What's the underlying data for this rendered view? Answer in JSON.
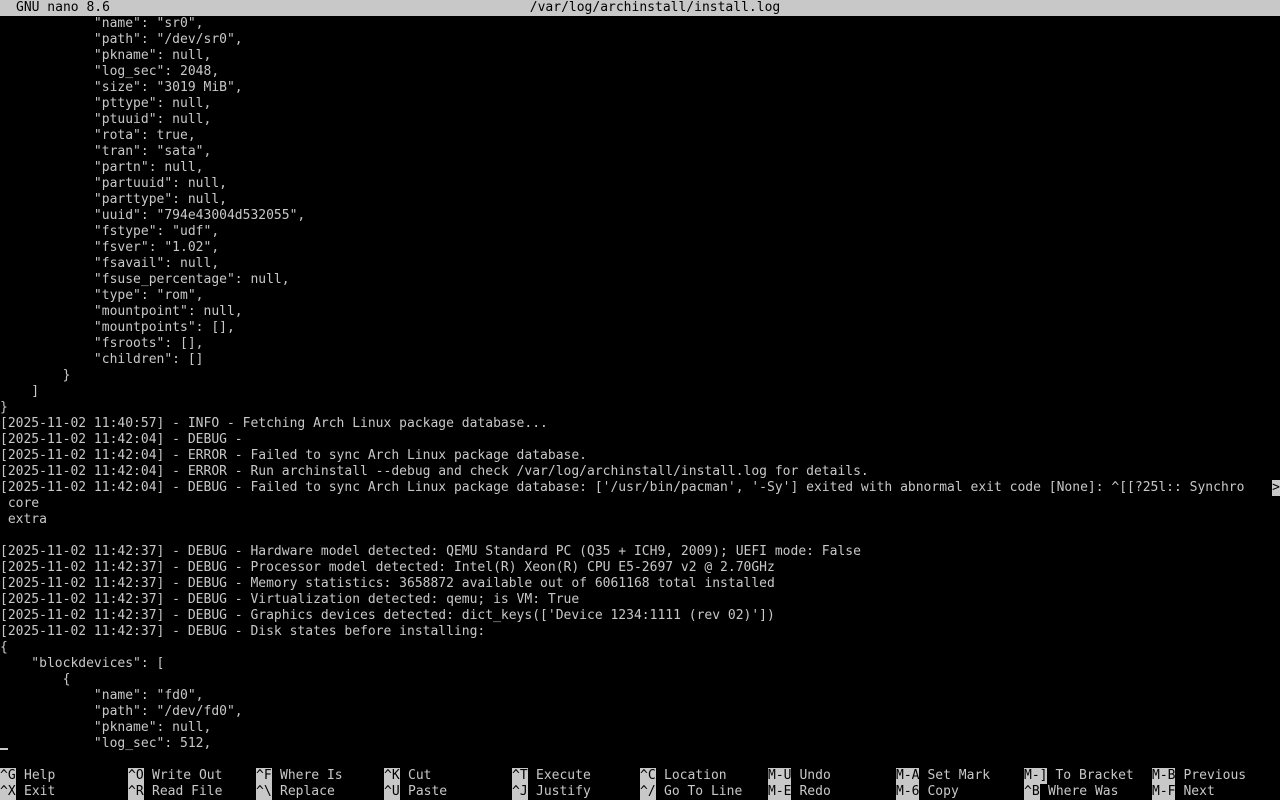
{
  "titlebar": {
    "app": "GNU nano 8.6",
    "filename": "/var/log/archinstall/install.log"
  },
  "lines": [
    "            \"name\": \"sr0\",",
    "            \"path\": \"/dev/sr0\",",
    "            \"pkname\": null,",
    "            \"log_sec\": 2048,",
    "            \"size\": \"3019 MiB\",",
    "            \"pttype\": null,",
    "            \"ptuuid\": null,",
    "            \"rota\": true,",
    "            \"tran\": \"sata\",",
    "            \"partn\": null,",
    "            \"partuuid\": null,",
    "            \"parttype\": null,",
    "            \"uuid\": \"794e43004d532055\",",
    "            \"fstype\": \"udf\",",
    "            \"fsver\": \"1.02\",",
    "            \"fsavail\": null,",
    "            \"fsuse_percentage\": null,",
    "            \"type\": \"rom\",",
    "            \"mountpoint\": null,",
    "            \"mountpoints\": [],",
    "            \"fsroots\": [],",
    "            \"children\": []",
    "        }",
    "    ]",
    "}",
    "[2025-11-02 11:40:57] - INFO - Fetching Arch Linux package database...",
    "[2025-11-02 11:42:04] - DEBUG -",
    "[2025-11-02 11:42:04] - ERROR - Failed to sync Arch Linux package database.",
    "[2025-11-02 11:42:04] - ERROR - Run archinstall --debug and check /var/log/archinstall/install.log for details.",
    "[2025-11-02 11:42:04] - DEBUG - Failed to sync Arch Linux package database: ['/usr/bin/pacman', '-Sy'] exited with abnormal exit code [None]: ^[[?25l:: Synchro",
    " core",
    " extra",
    "",
    "[2025-11-02 11:42:37] - DEBUG - Hardware model detected: QEMU Standard PC (Q35 + ICH9, 2009); UEFI mode: False",
    "[2025-11-02 11:42:37] - DEBUG - Processor model detected: Intel(R) Xeon(R) CPU E5-2697 v2 @ 2.70GHz",
    "[2025-11-02 11:42:37] - DEBUG - Memory statistics: 3658872 available out of 6061168 total installed",
    "[2025-11-02 11:42:37] - DEBUG - Virtualization detected: qemu; is VM: True",
    "[2025-11-02 11:42:37] - DEBUG - Graphics devices detected: dict_keys(['Device 1234:1111 (rev 02)'])",
    "[2025-11-02 11:42:37] - DEBUG - Disk states before installing:",
    "{",
    "    \"blockdevices\": [",
    "        {",
    "            \"name\": \"fd0\",",
    "            \"path\": \"/dev/fd0\",",
    "            \"pkname\": null,",
    "            \"log_sec\": 512,"
  ],
  "overflow_marker": ">",
  "overflow_line_index": 29,
  "shortcuts": [
    {
      "key": "^G",
      "label": "Help",
      "name": "help"
    },
    {
      "key": "^X",
      "label": "Exit",
      "name": "exit"
    },
    {
      "key": "^O",
      "label": "Write Out",
      "name": "write-out"
    },
    {
      "key": "^R",
      "label": "Read File",
      "name": "read-file"
    },
    {
      "key": "^F",
      "label": "Where Is",
      "name": "where-is"
    },
    {
      "key": "^\\",
      "label": "Replace",
      "name": "replace"
    },
    {
      "key": "^K",
      "label": "Cut",
      "name": "cut"
    },
    {
      "key": "^U",
      "label": "Paste",
      "name": "paste"
    },
    {
      "key": "^T",
      "label": "Execute",
      "name": "execute"
    },
    {
      "key": "^J",
      "label": "Justify",
      "name": "justify"
    },
    {
      "key": "^C",
      "label": "Location",
      "name": "location"
    },
    {
      "key": "^/",
      "label": "Go To Line",
      "name": "go-to-line"
    },
    {
      "key": "M-U",
      "label": "Undo",
      "name": "undo"
    },
    {
      "key": "M-E",
      "label": "Redo",
      "name": "redo"
    },
    {
      "key": "M-A",
      "label": "Set Mark",
      "name": "set-mark"
    },
    {
      "key": "M-6",
      "label": "Copy",
      "name": "copy"
    },
    {
      "key": "M-]",
      "label": "To Bracket",
      "name": "to-bracket"
    },
    {
      "key": "^B",
      "label": "Where Was",
      "name": "where-was"
    },
    {
      "key": "M-B",
      "label": "Previous",
      "name": "previous"
    },
    {
      "key": "M-F",
      "label": "Next",
      "name": "next"
    }
  ]
}
